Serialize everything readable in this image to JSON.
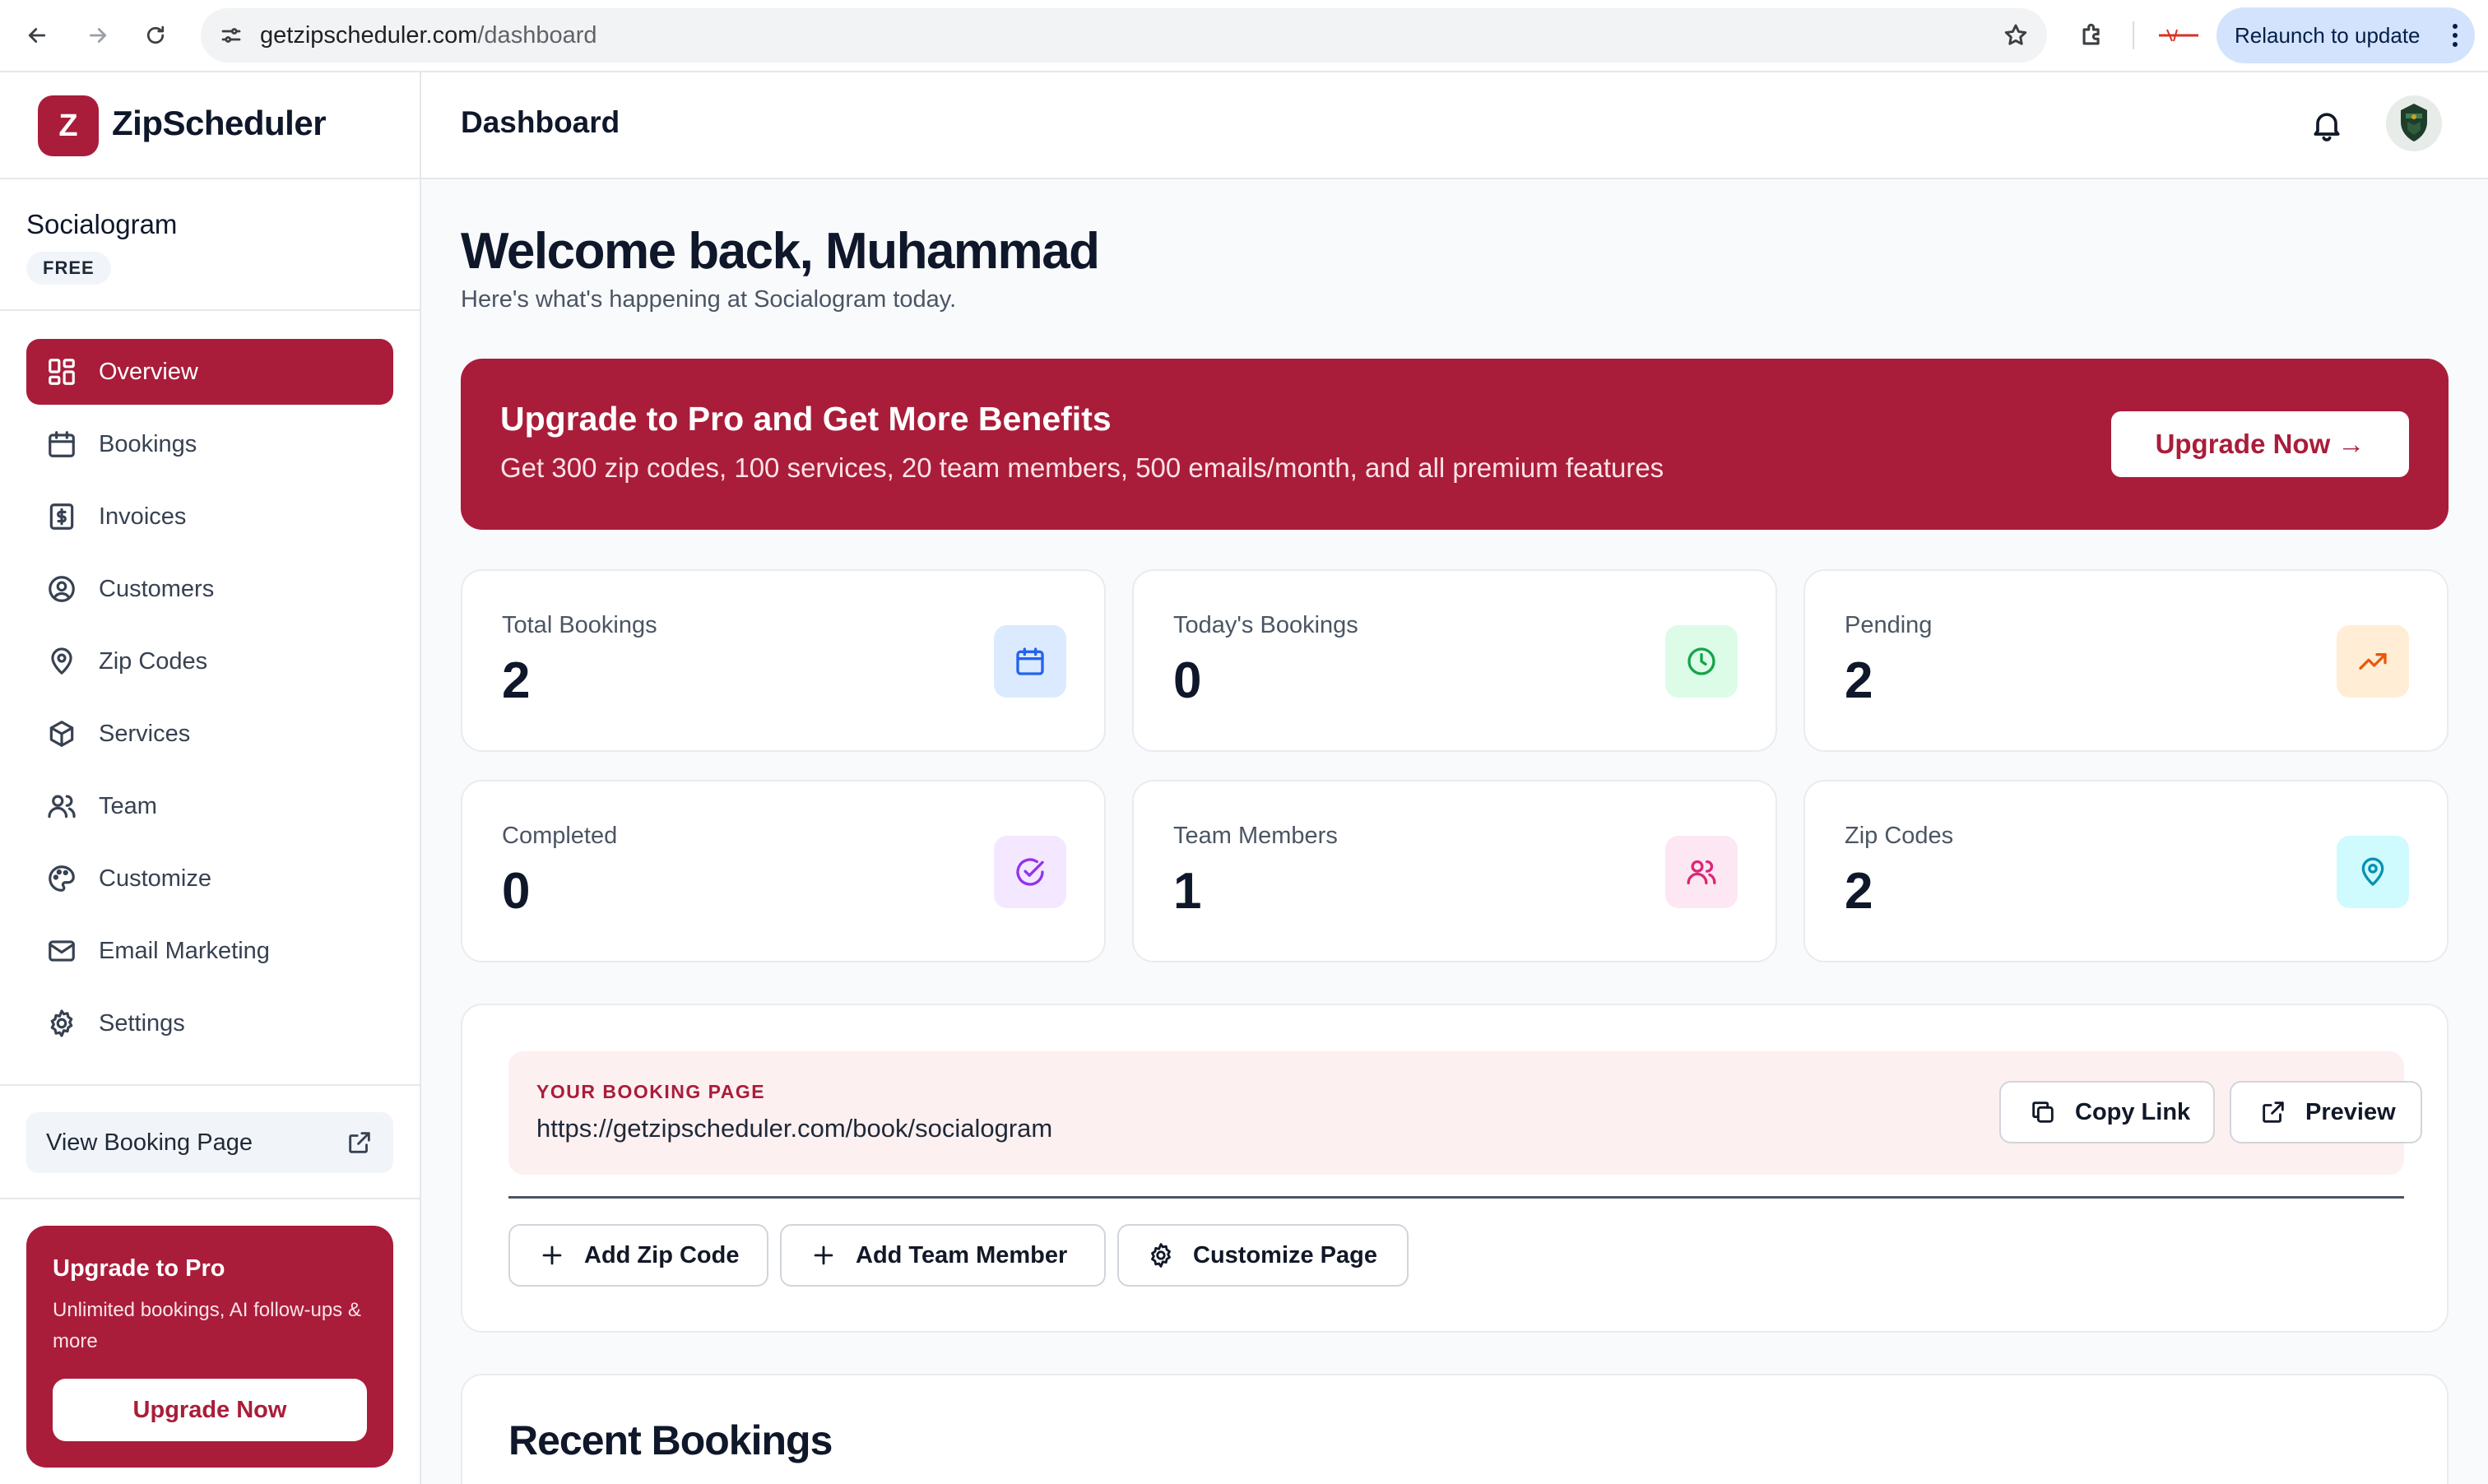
{
  "browser": {
    "url_host": "getzipscheduler.com",
    "url_path": "/dashboard",
    "relaunch_label": "Relaunch to update"
  },
  "brand": {
    "logo_letter": "Z",
    "name": "ZipScheduler",
    "accent_color": "#a91d3a"
  },
  "workspace": {
    "name": "Socialogram",
    "plan_badge": "FREE"
  },
  "sidebar": {
    "items": [
      {
        "label": "Overview",
        "icon": "grid-icon",
        "active": true
      },
      {
        "label": "Bookings",
        "icon": "calendar-icon"
      },
      {
        "label": "Invoices",
        "icon": "dollar-doc-icon"
      },
      {
        "label": "Customers",
        "icon": "user-circle-icon"
      },
      {
        "label": "Zip Codes",
        "icon": "map-pin-icon"
      },
      {
        "label": "Services",
        "icon": "box-icon"
      },
      {
        "label": "Team",
        "icon": "users-icon"
      },
      {
        "label": "Customize",
        "icon": "palette-icon"
      },
      {
        "label": "Email Marketing",
        "icon": "mail-icon"
      },
      {
        "label": "Settings",
        "icon": "gear-icon"
      }
    ],
    "view_booking_label": "View Booking Page",
    "promo": {
      "title": "Upgrade to Pro",
      "description": "Unlimited bookings, AI follow-ups & more",
      "button": "Upgrade Now"
    }
  },
  "header": {
    "title": "Dashboard"
  },
  "main": {
    "welcome_title": "Welcome back, Muhammad",
    "welcome_subtitle": "Here's what's happening at Socialogram today.",
    "banner": {
      "title": "Upgrade to Pro and Get More Benefits",
      "description": "Get 300 zip codes, 100 services, 20 team members, 500 emails/month, and all premium features",
      "button": "Upgrade Now →"
    },
    "stats": [
      {
        "label": "Total Bookings",
        "value": "2",
        "icon": "calendar-icon",
        "color": "#2563eb",
        "bg": "#dbeafe"
      },
      {
        "label": "Today's Bookings",
        "value": "0",
        "icon": "clock-icon",
        "color": "#16a34a",
        "bg": "#dcfce7"
      },
      {
        "label": "Pending",
        "value": "2",
        "icon": "trending-up-icon",
        "color": "#ea580c",
        "bg": "#ffedd5"
      },
      {
        "label": "Completed",
        "value": "0",
        "icon": "check-circle-icon",
        "color": "#9333ea",
        "bg": "#f3e8ff"
      },
      {
        "label": "Team Members",
        "value": "1",
        "icon": "users-icon",
        "color": "#db2777",
        "bg": "#fce7f3"
      },
      {
        "label": "Zip Codes",
        "value": "2",
        "icon": "map-pin-icon",
        "color": "#0891b2",
        "bg": "#cffafe"
      }
    ],
    "booking_page": {
      "label": "YOUR BOOKING PAGE",
      "url": "https://getzipscheduler.com/book/socialogram",
      "copy_button": "Copy Link",
      "preview_button": "Preview"
    },
    "quick_actions": [
      {
        "label": "Add Zip Code",
        "icon": "plus-icon"
      },
      {
        "label": "Add Team Member",
        "icon": "plus-icon"
      },
      {
        "label": "Customize Page",
        "icon": "gear-icon"
      }
    ],
    "recent_title": "Recent Bookings"
  }
}
